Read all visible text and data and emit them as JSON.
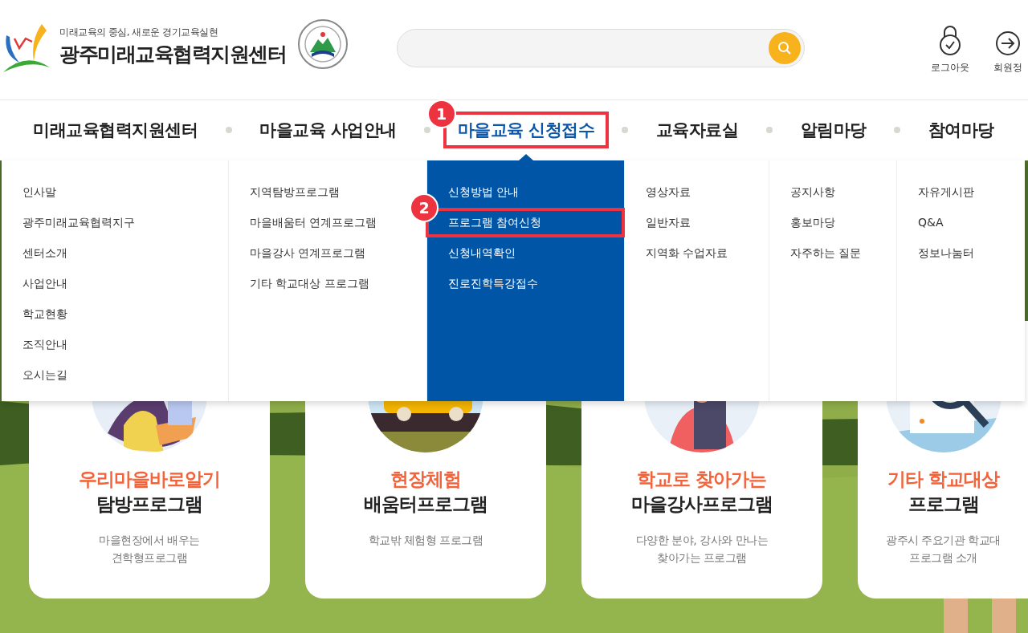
{
  "header": {
    "tagline": "미래교육의 중심, 새로운 경기교육실현",
    "site_title": "광주미래교육협력지원센터",
    "user_links": [
      {
        "kind": "logout",
        "label": "로그아웃"
      },
      {
        "kind": "member",
        "label": "회원정"
      }
    ]
  },
  "nav": [
    {
      "label": "미래교육협력지원센터",
      "selected": false
    },
    {
      "label": "마을교육 사업안내",
      "selected": false
    },
    {
      "label": "마을교육 신청접수",
      "selected": true,
      "callout": "1"
    },
    {
      "label": "교육자료실",
      "selected": false
    },
    {
      "label": "알림마당",
      "selected": false
    },
    {
      "label": "참여마당",
      "selected": false
    }
  ],
  "dropdown": {
    "columns": [
      {
        "items": [
          {
            "label": "인사말"
          },
          {
            "label": "광주미래교육협력지구"
          },
          {
            "label": "센터소개"
          },
          {
            "label": "사업안내"
          },
          {
            "label": "학교현황"
          },
          {
            "label": "조직안내"
          },
          {
            "label": "오시는길"
          }
        ]
      },
      {
        "items": [
          {
            "label": "지역탐방프로그램"
          },
          {
            "label": "마을배움터 연계프로그램"
          },
          {
            "label": "마을강사 연계프로그램"
          },
          {
            "label": "기타 학교대상 프로그램"
          }
        ]
      },
      {
        "items": [
          {
            "label": "신청방법 안내"
          },
          {
            "label": "프로그램 참여신청",
            "callout": "2"
          },
          {
            "label": "신청내역확인"
          },
          {
            "label": "진로진학특강접수"
          }
        ]
      },
      {
        "items": [
          {
            "label": "영상자료"
          },
          {
            "label": "일반자료"
          },
          {
            "label": "지역화 수업자료"
          }
        ]
      },
      {
        "items": [
          {
            "label": "공지사항"
          },
          {
            "label": "홍보마당"
          },
          {
            "label": "자주하는 질문"
          }
        ]
      },
      {
        "items": [
          {
            "label": "자유게시판"
          },
          {
            "label": "Q&A"
          },
          {
            "label": "정보나눔터"
          }
        ]
      }
    ]
  },
  "cards": [
    {
      "highlight": "우리마을바로알기",
      "title": "탐방프로그램",
      "description": [
        "마을현장에서 배우는",
        "견학형프로그램"
      ]
    },
    {
      "highlight": "현장체험",
      "title": "배움터프로그램",
      "description": [
        "학교밖 체험형 프로그램"
      ]
    },
    {
      "highlight": "학교로 찾아가는",
      "title": "마을강사프로그램",
      "description": [
        "다양한 분야, 강사와 만나는",
        "찾아가는 프로그램"
      ]
    },
    {
      "highlight": "기타 학교대상",
      "title": "프로그램",
      "description": [
        "광주시 주요기관 학교대",
        "프로그램 소개"
      ]
    }
  ]
}
